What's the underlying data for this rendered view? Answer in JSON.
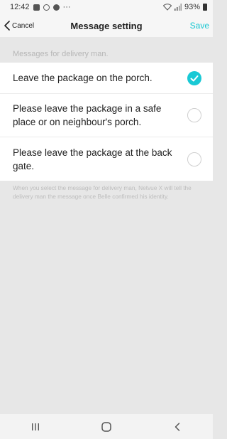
{
  "status_bar": {
    "time": "12:42",
    "more": "···",
    "battery": "93%"
  },
  "header": {
    "cancel_label": "Cancel",
    "title": "Message setting",
    "save_label": "Save"
  },
  "section_label": "Messages for delivery man.",
  "options": [
    {
      "text": "Leave the package on the porch.",
      "selected": true
    },
    {
      "text": "Please leave the package in a safe place or on neighbour's porch.",
      "selected": false
    },
    {
      "text": "Please leave the package at the back gate.",
      "selected": false
    }
  ],
  "note": "When you select the message for delivery man, Netvue X will tell the delivery man the message once Belle confirmed his identity.",
  "colors": {
    "accent": "#19c9d5",
    "background": "#e7e7e7"
  },
  "icons": {
    "back": "chevron-left-icon",
    "selected": "check-circle-icon",
    "nav_recents": "recents-icon",
    "nav_home": "home-icon",
    "nav_back": "back-icon"
  }
}
